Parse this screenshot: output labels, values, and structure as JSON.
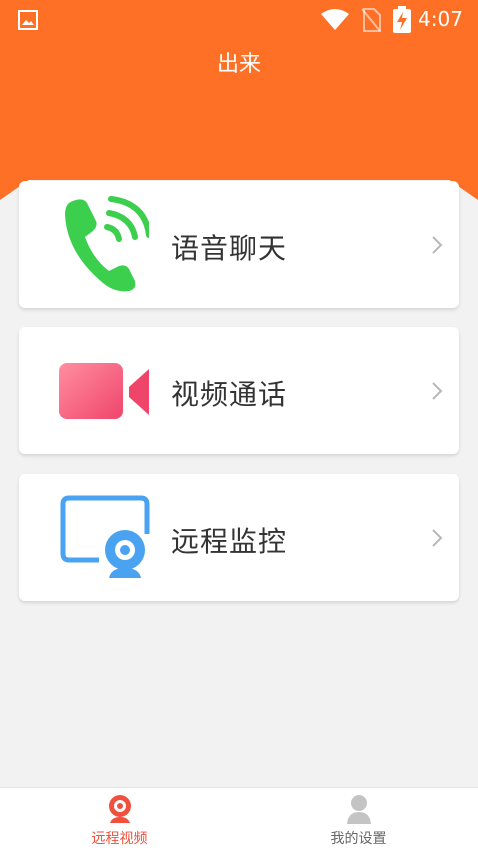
{
  "status_bar": {
    "time": "4:07"
  },
  "header": {
    "title": "出来"
  },
  "menu": [
    {
      "label": "语音聊天",
      "icon": "phone-call-icon"
    },
    {
      "label": "视频通话",
      "icon": "video-camera-icon"
    },
    {
      "label": "远程监控",
      "icon": "remote-monitor-icon"
    }
  ],
  "tabs": [
    {
      "label": "远程视频",
      "icon": "webcam-icon",
      "active": true
    },
    {
      "label": "我的设置",
      "icon": "user-icon",
      "active": false
    }
  ],
  "colors": {
    "header": "#fd7025",
    "active_tab": "#f0503c",
    "phone": "#3ccf4e",
    "video": "#f4577a",
    "monitor": "#4aa3f0"
  }
}
